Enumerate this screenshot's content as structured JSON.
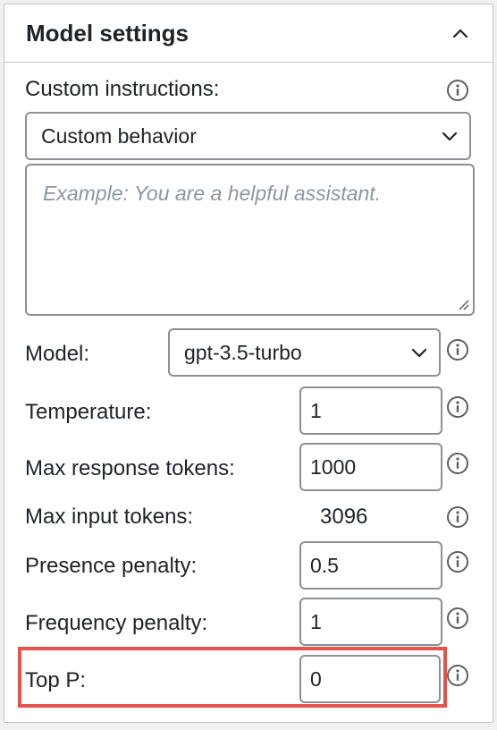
{
  "panel": {
    "title": "Model settings",
    "collapse_icon": "chevron-up-icon"
  },
  "custom_instructions": {
    "label": "Custom instructions:",
    "preset_selected": "Custom behavior",
    "textarea_value": "",
    "textarea_placeholder": "Example: You are a helpful assistant."
  },
  "model": {
    "label": "Model:",
    "selected": "gpt-3.5-turbo"
  },
  "temperature": {
    "label": "Temperature:",
    "value": "1"
  },
  "max_response_tokens": {
    "label": "Max response tokens:",
    "value": "1000"
  },
  "max_input_tokens": {
    "label": "Max input tokens:",
    "value": "3096"
  },
  "presence_penalty": {
    "label": "Presence penalty:",
    "value": "0.5"
  },
  "frequency_penalty": {
    "label": "Frequency penalty:",
    "value": "1"
  },
  "top_p": {
    "label": "Top P:",
    "value": "0",
    "highlighted": true
  },
  "colors": {
    "highlight": "#e5534b",
    "border": "#8c8f94",
    "text": "#1d2327",
    "placeholder": "#8c96a0",
    "icon": "#5b5f63"
  }
}
